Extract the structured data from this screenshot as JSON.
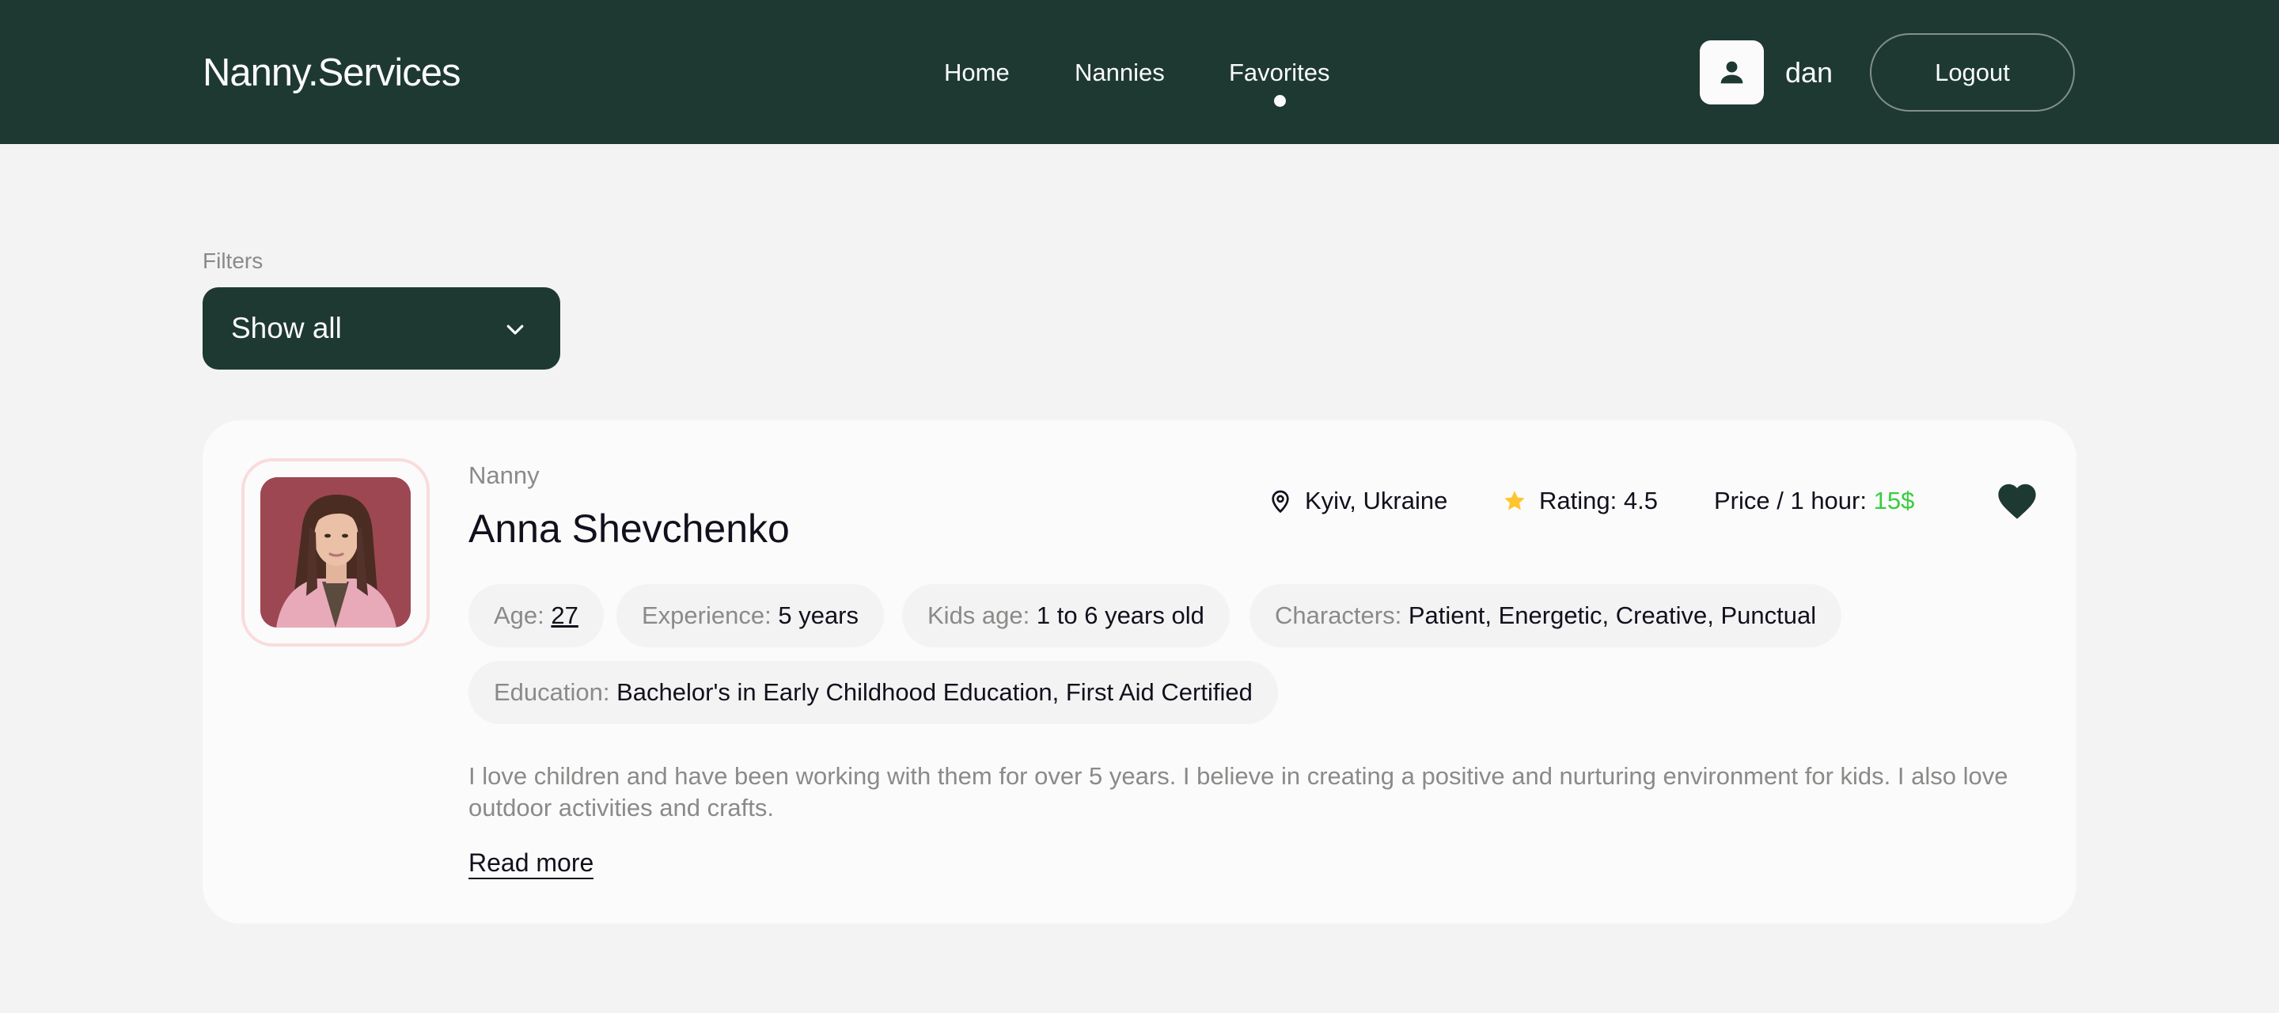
{
  "header": {
    "logo": "Nanny.Services",
    "nav": [
      {
        "label": "Home",
        "active": false
      },
      {
        "label": "Nannies",
        "active": false
      },
      {
        "label": "Favorites",
        "active": true
      }
    ],
    "user_name": "dan",
    "user_icon": "user-icon",
    "logout_label": "Logout"
  },
  "filters": {
    "label": "Filters",
    "selected": "Show all",
    "icon": "chevron-down-icon"
  },
  "nanny": {
    "role": "Nanny",
    "name": "Anna Shevchenko",
    "location": "Kyiv, Ukraine",
    "location_icon": "map-pin-icon",
    "rating": "Rating: 4.5",
    "rating_icon": "star-icon",
    "price_label": "Price / 1 hour: ",
    "price_value": "15$",
    "favorite_icon": "heart-icon",
    "favorited": true,
    "chips": {
      "age_label": "Age:",
      "age_value": "27",
      "experience_label": "Experience:",
      "experience_value": "5 years",
      "kids_age_label": "Kids age:",
      "kids_age_value": "1 to 6 years old",
      "characters_label": "Characters:",
      "characters_value": "Patient, Energetic, Creative, Punctual",
      "education_label": "Education:",
      "education_value": "Bachelor's in Early Childhood Education, First Aid Certified"
    },
    "about": "I love children and have been working with them for over 5 years. I believe in creating a positive and nurturing environment for kids. I also love outdoor activities and crafts.",
    "read_more": "Read more"
  },
  "colors": {
    "brand_dark": "#1e3932",
    "page_bg": "#f3f3f3",
    "card_bg": "#fbfbfb",
    "price_green": "#38cd3e",
    "star_yellow": "#ffc531",
    "muted_text": "#8a8a89"
  }
}
